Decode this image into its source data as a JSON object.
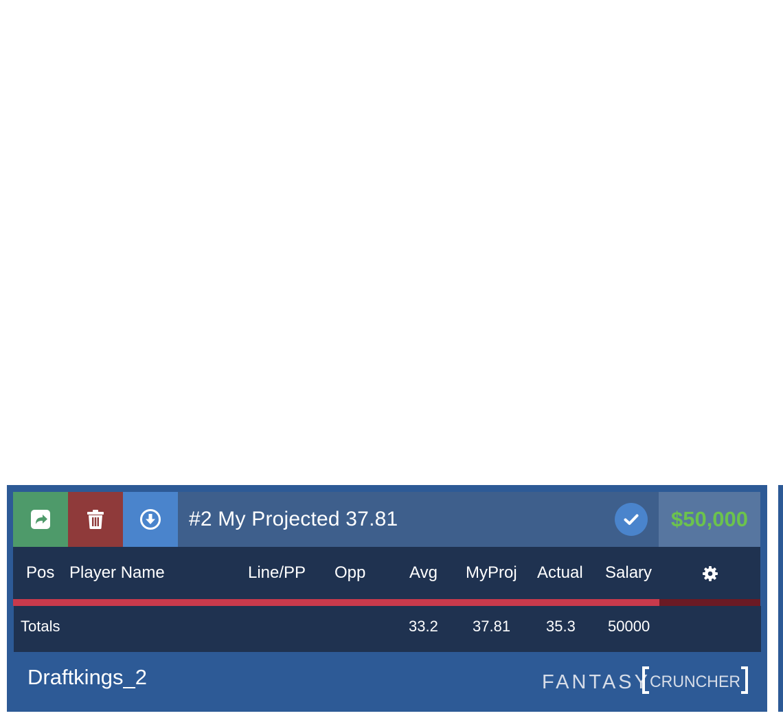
{
  "lineup": {
    "title": "#2 My Projected 37.81",
    "salary_total": "$50,000",
    "colors": {
      "share": "#4e9a6a",
      "delete": "#8f3a3a",
      "download": "#4a84cc",
      "salary_text": "#6cc34d",
      "progress_fill": "#c93a4c",
      "progress_track": "#6b1a24"
    },
    "icons": {
      "share": "share-icon",
      "delete": "trash-icon",
      "download": "download-circle-icon",
      "confirm": "check-circle-icon",
      "settings": "gear-icon"
    },
    "salary_progress_fraction": 0.865
  },
  "columns": {
    "pos": "Pos",
    "player_name": "Player Name",
    "line_pp": "Line/PP",
    "opp": "Opp",
    "avg": "Avg",
    "myproj": "MyProj",
    "actual": "Actual",
    "salary": "Salary"
  },
  "totals": {
    "label": "Totals",
    "avg": "33.2",
    "myproj": "37.81",
    "actual": "35.3",
    "salary": "50000"
  },
  "footer": {
    "site_name": "Draftkings_2",
    "logo_text_1": "FANTASY",
    "logo_text_2": "CRUNCHER"
  }
}
